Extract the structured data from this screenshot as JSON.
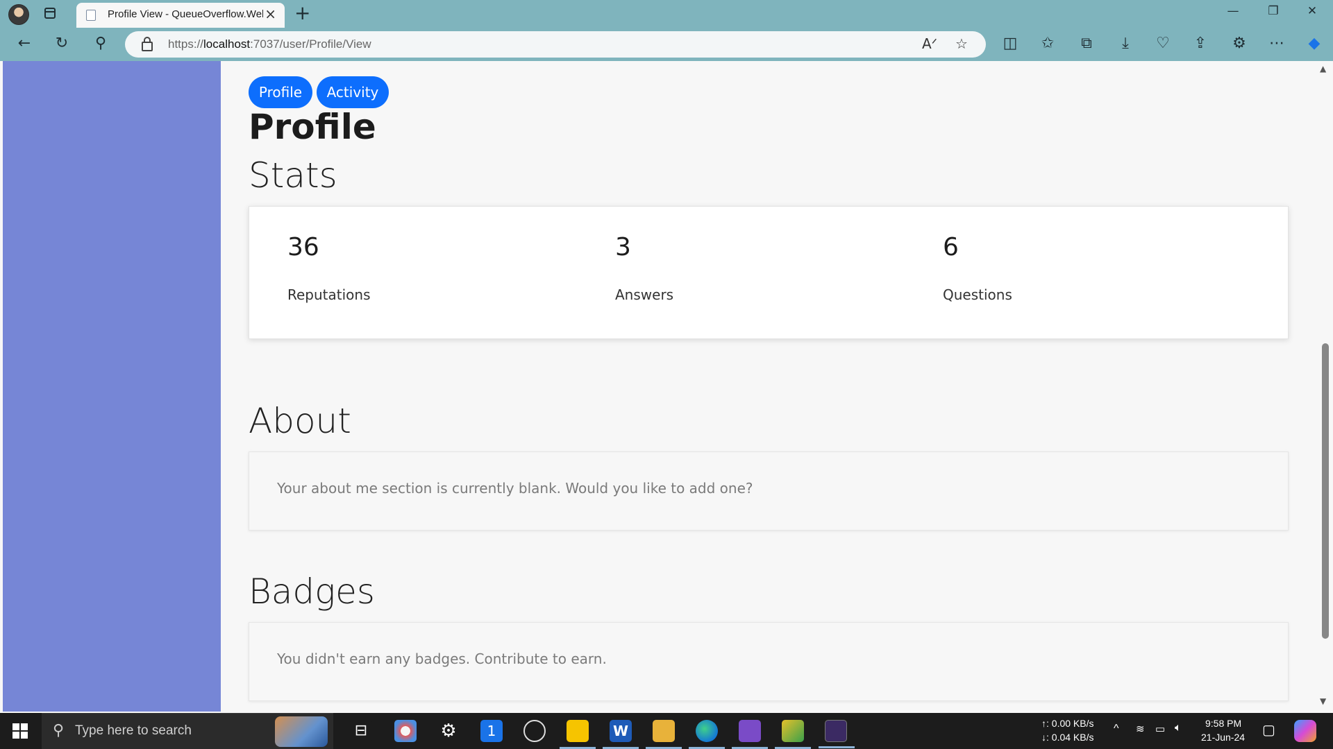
{
  "browser": {
    "tab_title": "Profile View - QueueOverflow.Web",
    "tab_close": "×",
    "new_tab": "+",
    "url_prefix": "https://",
    "url_host": "localhost",
    "url_rest": ":7037/user/Profile/View",
    "window_controls": {
      "minimize": "—",
      "restore": "❐",
      "close": "✕"
    },
    "icons": [
      "back-icon",
      "refresh-icon",
      "search-icon",
      "read-aloud-icon",
      "favorite-star-icon",
      "split-screen-icon",
      "favorites-icon",
      "collections-icon",
      "downloads-icon",
      "browser-essentials-icon",
      "share-icon",
      "extensions-icon",
      "more-icon",
      "copilot-icon"
    ]
  },
  "page": {
    "nav_pills": [
      "Profile",
      "Activity"
    ],
    "title": "Profile",
    "stats_heading": "Stats",
    "stats": [
      {
        "value": "36",
        "label": "Reputations"
      },
      {
        "value": "3",
        "label": "Answers"
      },
      {
        "value": "6",
        "label": "Questions"
      }
    ],
    "about_heading": "About",
    "about_text": "Your about me section is currently blank. Would you like to add one?",
    "badges_heading": "Badges",
    "badges_text": "You didn't earn any badges. Contribute to earn."
  },
  "colors": {
    "sidebar": "#7686d6",
    "pill": "#0d6efd",
    "browser_chrome": "#7fb4bd"
  },
  "taskbar": {
    "search_placeholder": "Type here to search",
    "upload_speed": "↑: 0.00 KB/s",
    "download_speed": "↓: 0.04 KB/s",
    "time": "9:58 PM",
    "date": "21-Jun-24",
    "apps": [
      "task-view-icon",
      "paint-icon",
      "settings-icon",
      "onepassword-icon",
      "obs-icon",
      "sticky-notes-icon",
      "word-icon",
      "file-explorer-icon",
      "edge-icon",
      "visual-studio-icon",
      "snipping-icon",
      "terminal-icon"
    ]
  }
}
